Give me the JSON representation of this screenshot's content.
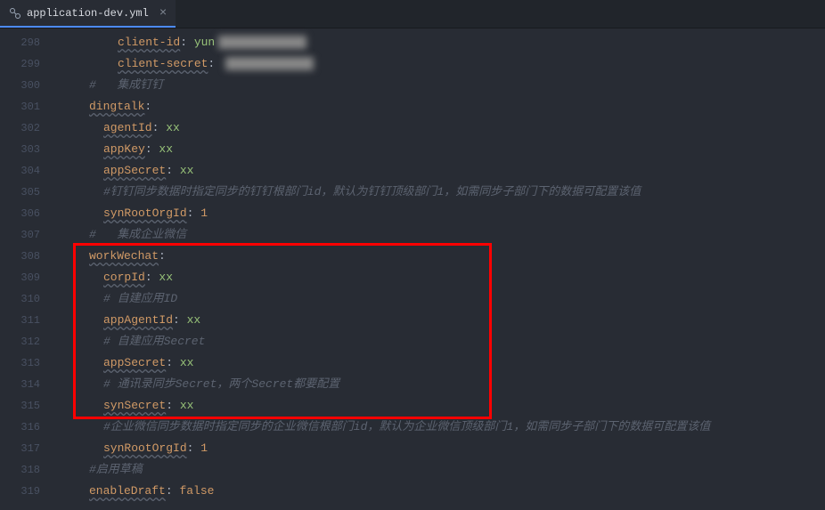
{
  "tab": {
    "filename": "application-dev.yml",
    "close_char": "×"
  },
  "lines": [
    {
      "num": "298",
      "indent": 3,
      "type": "kv",
      "key": "client-id",
      "colon": ": ",
      "value": "yun",
      "blur": true
    },
    {
      "num": "299",
      "indent": 3,
      "type": "kv",
      "key": "client-secret",
      "colon": ": ",
      "value": "",
      "blur": true
    },
    {
      "num": "300",
      "indent": 1,
      "type": "comment",
      "text": "#   集成钉钉"
    },
    {
      "num": "301",
      "indent": 1,
      "type": "key",
      "key": "dingtalk",
      "colon": ":"
    },
    {
      "num": "302",
      "indent": 2,
      "type": "kv",
      "key": "agentId",
      "colon": ": ",
      "value": "xx"
    },
    {
      "num": "303",
      "indent": 2,
      "type": "kv",
      "key": "appKey",
      "colon": ": ",
      "value": "xx"
    },
    {
      "num": "304",
      "indent": 2,
      "type": "kv",
      "key": "appSecret",
      "colon": ": ",
      "value": "xx"
    },
    {
      "num": "305",
      "indent": 2,
      "type": "comment",
      "text": "#钉钉同步数据时指定同步的钉钉根部门id，默认为钉钉顶级部门1，如需同步子部门下的数据可配置该值"
    },
    {
      "num": "306",
      "indent": 2,
      "type": "kvnum",
      "key": "synRootOrgId",
      "colon": ": ",
      "value": "1"
    },
    {
      "num": "307",
      "indent": 1,
      "type": "comment",
      "text": "#   集成企业微信"
    },
    {
      "num": "308",
      "indent": 1,
      "type": "key",
      "key": "workWechat",
      "colon": ":"
    },
    {
      "num": "309",
      "indent": 2,
      "type": "kv",
      "key": "corpId",
      "colon": ": ",
      "value": "xx"
    },
    {
      "num": "310",
      "indent": 2,
      "type": "comment",
      "text": "# 自建应用ID"
    },
    {
      "num": "311",
      "indent": 2,
      "type": "kv",
      "key": "appAgentId",
      "colon": ": ",
      "value": "xx"
    },
    {
      "num": "312",
      "indent": 2,
      "type": "comment",
      "text": "# 自建应用Secret"
    },
    {
      "num": "313",
      "indent": 2,
      "type": "kv",
      "key": "appSecret",
      "colon": ": ",
      "value": "xx"
    },
    {
      "num": "314",
      "indent": 2,
      "type": "comment",
      "text": "# 通讯录同步Secret，两个Secret都要配置"
    },
    {
      "num": "315",
      "indent": 2,
      "type": "kv",
      "key": "synSecret",
      "colon": ": ",
      "value": "xx"
    },
    {
      "num": "316",
      "indent": 2,
      "type": "comment",
      "text": "#企业微信同步数据时指定同步的企业微信根部门id，默认为企业微信顶级部门1，如需同步子部门下的数据可配置该值"
    },
    {
      "num": "317",
      "indent": 2,
      "type": "kvnum",
      "key": "synRootOrgId",
      "colon": ": ",
      "value": "1"
    },
    {
      "num": "318",
      "indent": 1,
      "type": "comment",
      "text": "#启用草稿"
    },
    {
      "num": "319",
      "indent": 1,
      "type": "kvbool",
      "key": "enableDraft",
      "colon": ": ",
      "value": "false"
    }
  ],
  "highlight": {
    "start_line": "308",
    "end_line": "315"
  }
}
